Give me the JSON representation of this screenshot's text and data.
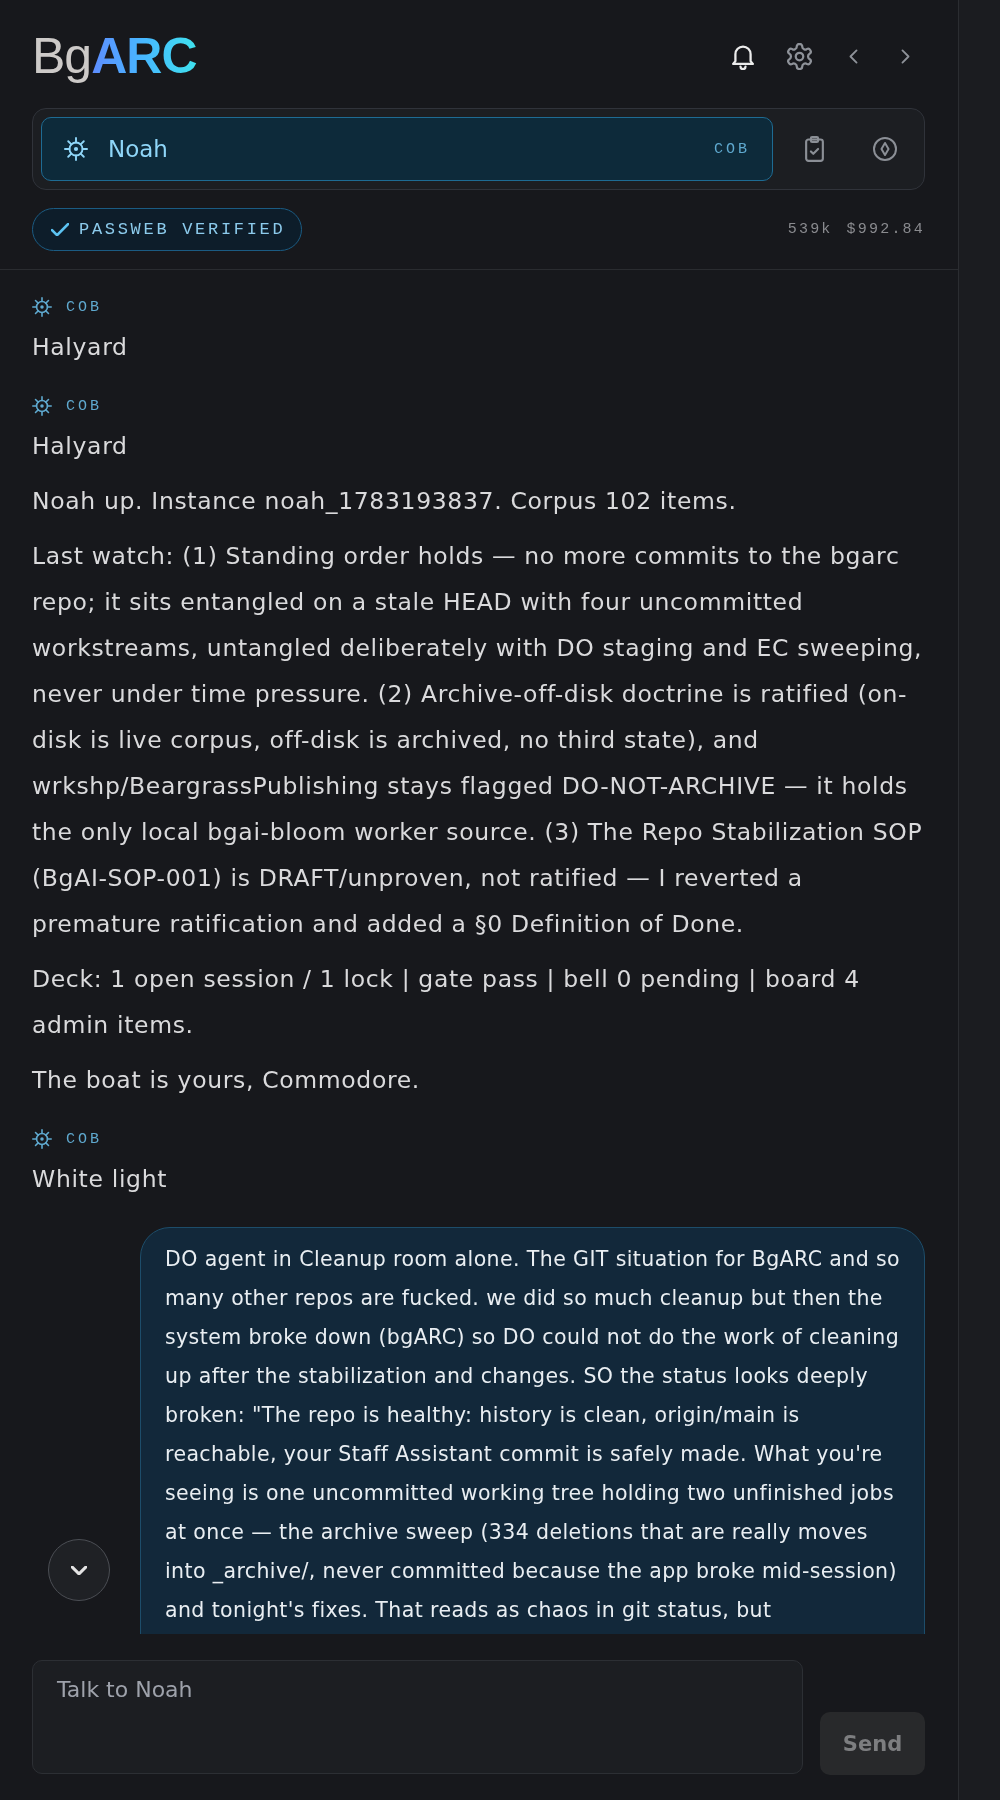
{
  "header": {
    "logo": "Bg**ARC**",
    "agent": {
      "name": "Noah",
      "role": "COB",
      "selected": true
    },
    "verification": {
      "label": "PASSWEB VERIFIED"
    },
    "usage": {
      "tokens": "539k",
      "cost": "$992.84"
    }
  },
  "messages": [
    {
      "kind": "agent",
      "role": "COB",
      "paragraphs": [
        "Halyard"
      ]
    },
    {
      "kind": "agent",
      "role": "COB",
      "paragraphs": [
        "Halyard",
        "Noah up. Instance noah_1783193837. Corpus 102 items.",
        "Last watch: (1) Standing order holds — no more commits to the bgarc repo; it sits entangled on a stale HEAD with four uncommitted workstreams, untangled deliberately with DO staging and EC sweeping, never under time pressure. (2) Archive-off-disk doctrine is ratified (on-disk is live corpus, off-disk is archived, no third state), and wrkshp/BeargrassPublishing stays flagged DO-NOT-ARCHIVE — it holds the only local bgai-bloom worker source. (3) The Repo Stabilization SOP (BgAI-SOP-001) is DRAFT/unproven, not ratified — I reverted a premature ratification and added a §0 Definition of Done.",
        "Deck: 1 open session / 1 lock | gate pass | bell 0 pending | board 4 admin items.",
        "The boat is yours, Commodore."
      ]
    },
    {
      "kind": "agent",
      "role": "COB",
      "paragraphs": [
        "White light"
      ]
    },
    {
      "kind": "user",
      "paragraphs": [
        "DO agent in Cleanup room alone. The GIT situation for BgARC and so many other repos are fucked. we did so much cleanup but then the system broke down (bgARC) so DO could not do the work of cleaning up after the stabilization and changes. SO the status looks deeply broken: \"The repo is healthy: history is clean, origin/main is reachable, your Staff Assistant commit is safely made. What you're seeing is one uncommitted working tree holding two unfinished jobs at once — the archive sweep (334 deletions that are really moves into _archive/, never committed because the app broke mid-session) and tonight's fixes. That reads as chaos in git status, but"
      ]
    }
  ],
  "composer": {
    "placeholder": "Talk to Noah",
    "send": {
      "label": "Send",
      "disabled": true
    }
  }
}
